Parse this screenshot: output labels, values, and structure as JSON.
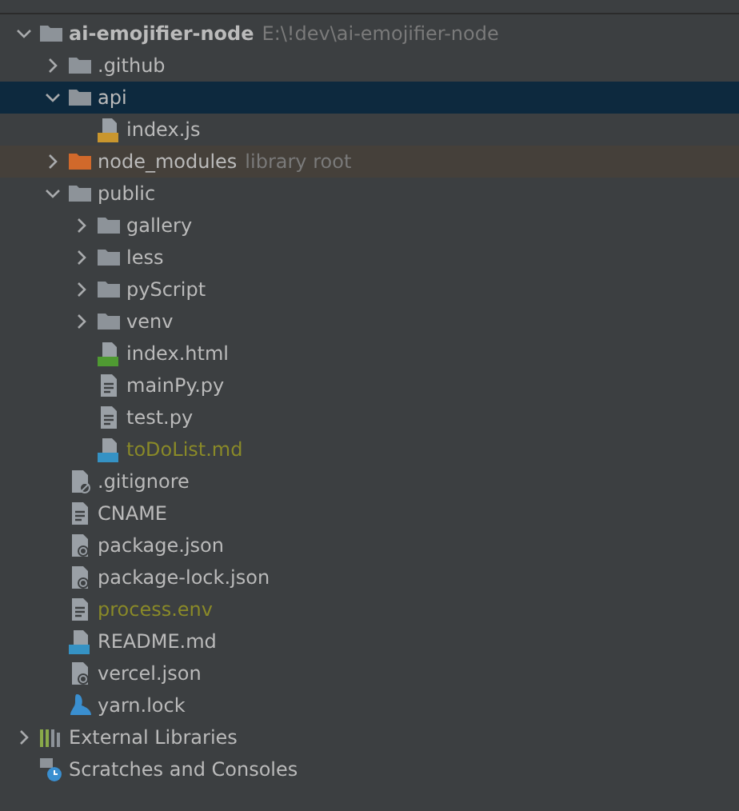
{
  "tree": [
    {
      "name": "ai-emojifier-node",
      "kind": "project",
      "expanded": true,
      "selected": false,
      "note": "E:\\!dev\\ai-emojifier-node",
      "children": [
        {
          "name": ".github",
          "kind": "folder",
          "expanded": false,
          "selected": false
        },
        {
          "name": "api",
          "kind": "folder",
          "expanded": true,
          "selected": true,
          "children": [
            {
              "name": "index.js",
              "kind": "js",
              "selected": false
            }
          ]
        },
        {
          "name": "node_modules",
          "kind": "library_folder",
          "expanded": false,
          "selected": false,
          "note": "library root"
        },
        {
          "name": "public",
          "kind": "folder",
          "expanded": true,
          "selected": false,
          "children": [
            {
              "name": "gallery",
              "kind": "folder",
              "expanded": false,
              "selected": false
            },
            {
              "name": "less",
              "kind": "folder",
              "expanded": false,
              "selected": false
            },
            {
              "name": "pyScript",
              "kind": "folder",
              "expanded": false,
              "selected": false
            },
            {
              "name": "venv",
              "kind": "folder",
              "expanded": false,
              "selected": false
            },
            {
              "name": "index.html",
              "kind": "html",
              "selected": false
            },
            {
              "name": "mainPy.py",
              "kind": "text",
              "selected": false
            },
            {
              "name": "test.py",
              "kind": "text",
              "selected": false
            },
            {
              "name": "toDoList.md",
              "kind": "md",
              "selected": false,
              "ignored": true
            }
          ]
        },
        {
          "name": ".gitignore",
          "kind": "ignore",
          "selected": false
        },
        {
          "name": "CNAME",
          "kind": "text",
          "selected": false
        },
        {
          "name": "package.json",
          "kind": "json",
          "selected": false
        },
        {
          "name": "package-lock.json",
          "kind": "json",
          "selected": false
        },
        {
          "name": "process.env",
          "kind": "text",
          "selected": false,
          "ignored": true
        },
        {
          "name": "README.md",
          "kind": "md",
          "selected": false
        },
        {
          "name": "vercel.json",
          "kind": "json",
          "selected": false
        },
        {
          "name": "yarn.lock",
          "kind": "yarn",
          "selected": false
        }
      ]
    },
    {
      "name": "External Libraries",
      "kind": "libraries",
      "expanded": false,
      "selected": false
    },
    {
      "name": "Scratches and Consoles",
      "kind": "scratches",
      "selected": false
    }
  ]
}
